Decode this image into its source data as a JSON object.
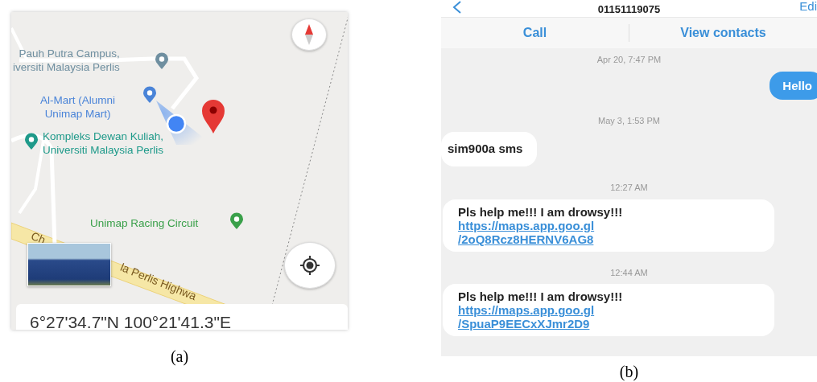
{
  "figure_a": {
    "map": {
      "places": [
        {
          "lines": [
            "Pauh Putra Campus,",
            "iversiti Malaysia Perlis"
          ],
          "color": "#6f8fa0"
        },
        {
          "lines": [
            "Al-Mart (Alumni",
            "Unimap Mart)"
          ],
          "color": "#4a84d8"
        },
        {
          "lines": [
            "Kompleks Dewan Kuliah,",
            "Universiti Malaysia Perlis"
          ],
          "color": "#1f9a8a"
        },
        {
          "lines": [
            "Unimap Racing Circuit"
          ],
          "color": "#3aa04a"
        }
      ],
      "road_labels": [
        "Ch",
        "la Perlis Highwa"
      ],
      "coordinates": "6°27'34.7\"N 100°21'41.3\"E"
    },
    "caption": "(a)"
  },
  "figure_b": {
    "header": {
      "phone": "01151119075",
      "edit": "Edi"
    },
    "actions": [
      "Call",
      "View contacts"
    ],
    "messages": [
      {
        "kind": "time",
        "text": "Apr 20, 7:47 PM"
      },
      {
        "kind": "outgoing",
        "text": "Hello"
      },
      {
        "kind": "time",
        "text": "May 3, 1:53 PM"
      },
      {
        "kind": "incoming",
        "text": "sim900a sms"
      },
      {
        "kind": "time",
        "text": "12:27 AM"
      },
      {
        "kind": "incoming",
        "text": "Pls help me!!! I am drowsy!!!",
        "link_lines": [
          "https://maps.app.goo.gl",
          "/2oQ8Rcz8HERNV6AG8"
        ]
      },
      {
        "kind": "time",
        "text": "12:44 AM"
      },
      {
        "kind": "incoming",
        "text": "Pls help me!!! I am drowsy!!!",
        "link_lines": [
          "https://maps.app.goo.gl",
          "/SpuaP9EECxXJmr2D9"
        ]
      }
    ],
    "caption": "(b)"
  }
}
